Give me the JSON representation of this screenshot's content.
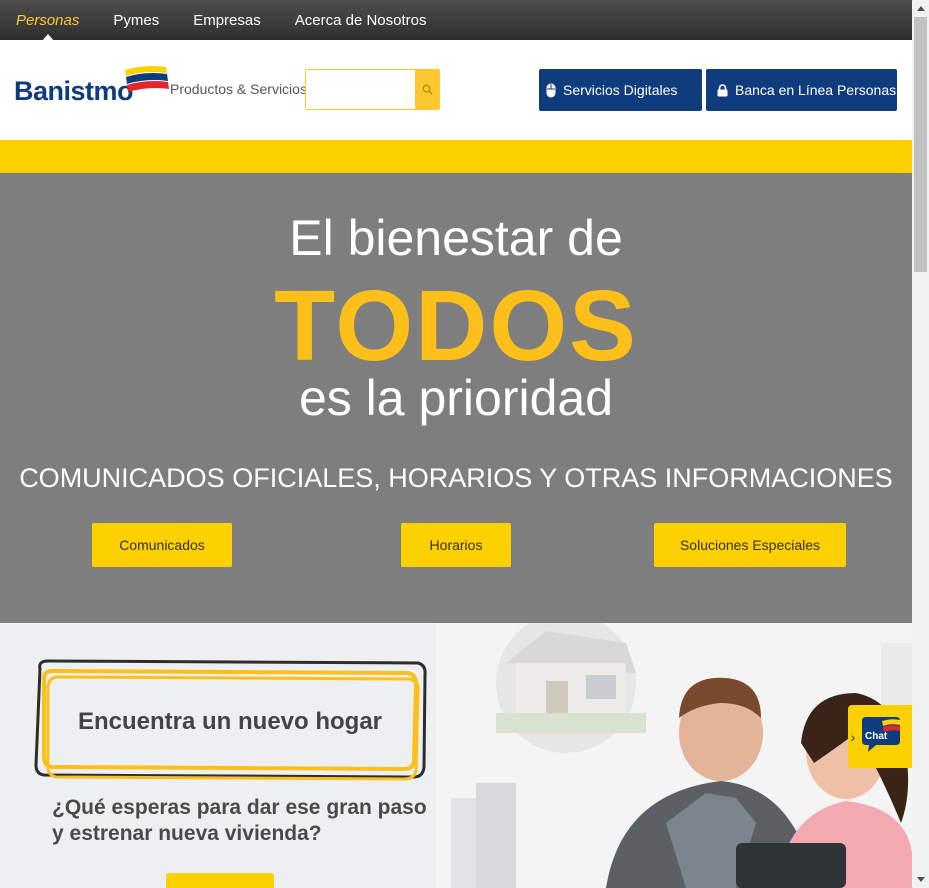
{
  "topnav": {
    "items": [
      {
        "label": "Personas",
        "active": true
      },
      {
        "label": "Pymes"
      },
      {
        "label": "Empresas"
      },
      {
        "label": "Acerca de Nosotros"
      }
    ]
  },
  "header": {
    "logo_text": "Banistmo",
    "products_label": "Productos & Servicios",
    "search_value": "",
    "search_icon": "search-icon",
    "digital_label": "Servicios Digitales",
    "digital_icon": "mouse-icon",
    "banca_label": "Banca en Línea Personas",
    "banca_icon": "lock-icon"
  },
  "hero": {
    "line1": "El bienestar de",
    "line2": "TODOS",
    "line3": "es la prioridad",
    "subtitle": "COMUNICADOS OFICIALES, HORARIOS Y OTRAS INFORMACIONES",
    "buttons": [
      "Comunicados",
      "Horarios",
      "Soluciones Especiales"
    ]
  },
  "promo": {
    "title": "Encuentra un nuevo hogar",
    "text": "¿Qué esperas para dar ese gran paso y estrenar nueva vivienda?"
  },
  "chat": {
    "label": "Chat"
  },
  "colors": {
    "brand_blue": "#0f3c7d",
    "brand_yellow": "#fdd000",
    "hero_gray": "#7e7e7e",
    "accent_red": "#e4262c"
  }
}
